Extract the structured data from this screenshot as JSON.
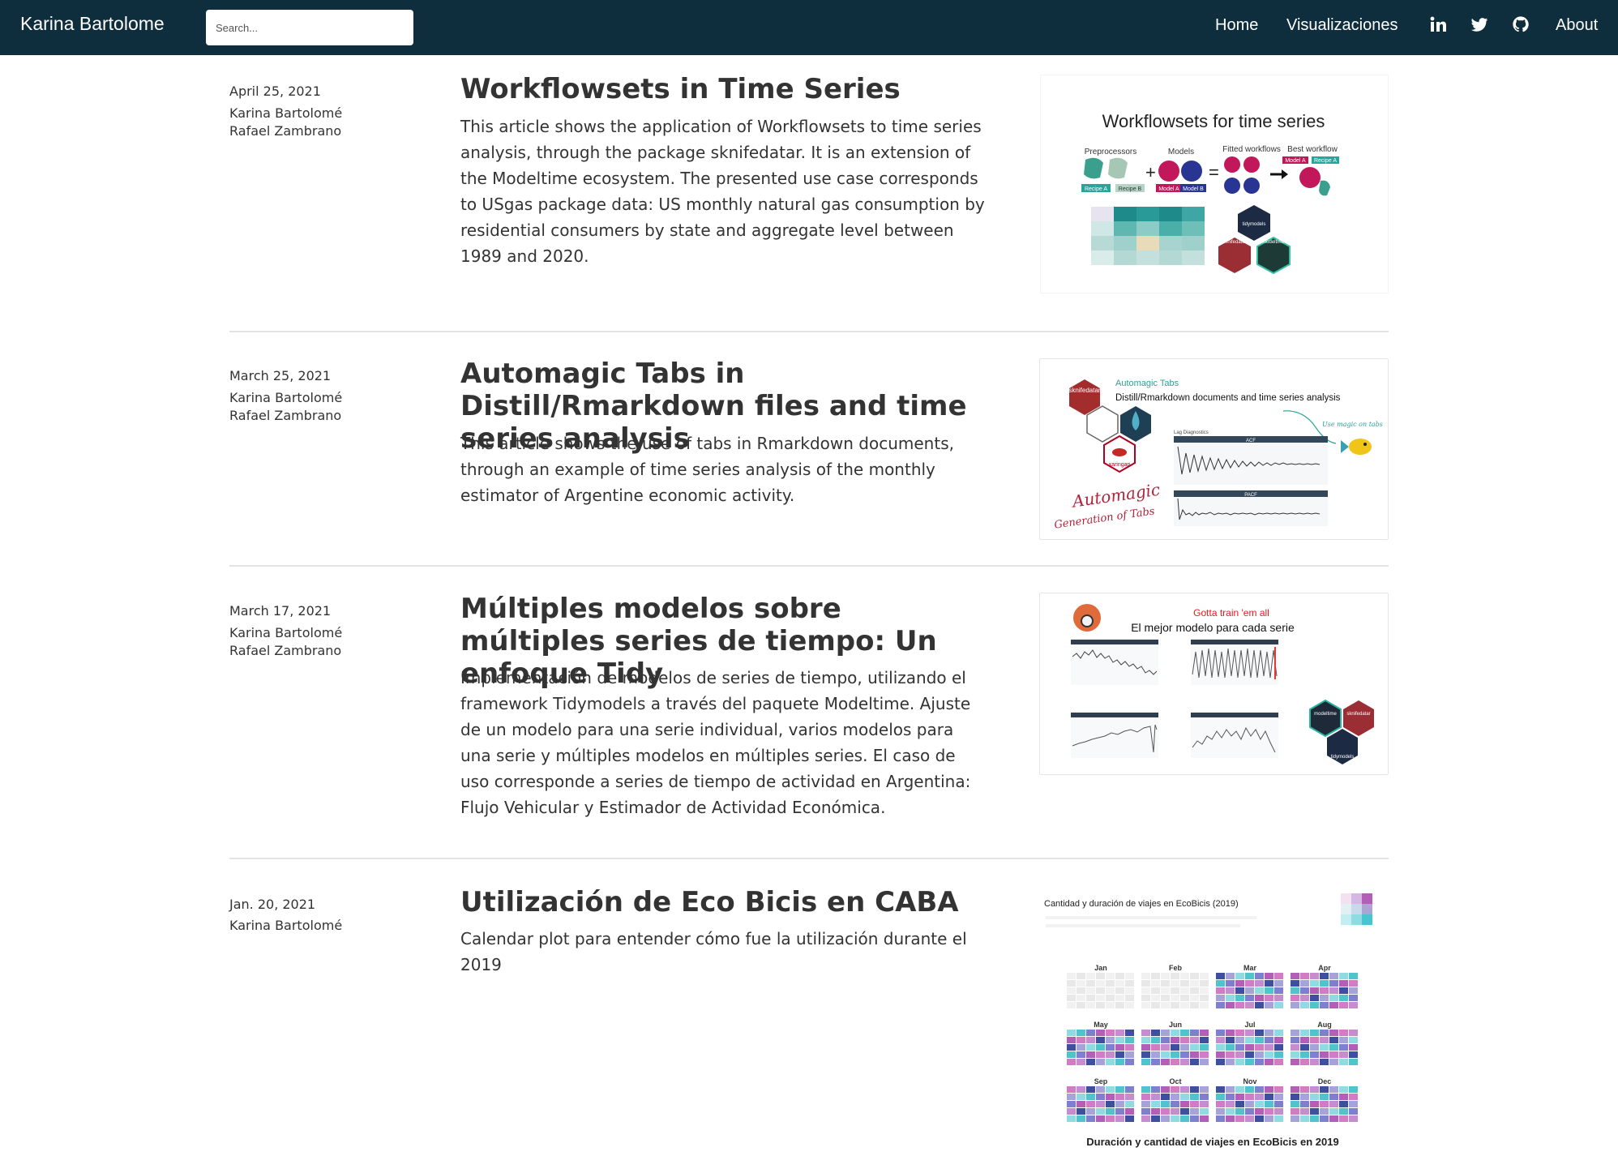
{
  "navbar": {
    "brand": "Karina Bartolome",
    "search_placeholder": "Search...",
    "links": {
      "home": "Home",
      "viz": "Visualizaciones",
      "about": "About"
    },
    "icons": [
      "linkedin-icon",
      "twitter-icon",
      "github-icon"
    ]
  },
  "articles": [
    {
      "date": "April 25, 2021",
      "authors": [
        "Karina Bartolomé",
        "Rafael Zambrano"
      ],
      "title": "Workflowsets in Time Series",
      "description": "This article shows the application of Workflowsets to time series analysis, through the package sknifedatar. It is an extension of the Modeltime ecosystem. The presented use case corresponds to USgas package data: US monthly natural gas consumption by residential consumers by state and aggregate level between 1989 and 2020.",
      "thumb": {
        "title": "Workflowsets for time series",
        "labels": [
          "Preprocessors",
          "Models",
          "Fitted workflows",
          "Best workflow"
        ],
        "tags": [
          "Recipe A",
          "Recipe B",
          "Model A",
          "Model B",
          "Model A",
          "Recipe A"
        ],
        "hex": [
          "tidymodels",
          "sknifedatar",
          "modeltime"
        ]
      }
    },
    {
      "date": "March 25, 2021",
      "authors": [
        "Karina Bartolomé",
        "Rafael Zambrano"
      ],
      "title": "Automagic Tabs in Distill/Rmarkdown files and time series analysis",
      "description": "This article shows the use of tabs in Rmarkdown documents, through an example of time series analysis of the monthly estimator of Argentine economic activity.",
      "thumb": {
        "kicker": "Automagic Tabs",
        "title": "Distill/Rmarkdown documents and time series analysis",
        "hex": [
          "sknifedatar",
          "xaringan"
        ],
        "script1": "Automagic",
        "script2": "Generation of Tabs",
        "note": "Use magic on tabs",
        "panel_title": "Lag Diagnostics",
        "acf": "ACF",
        "pacf": "PACF"
      }
    },
    {
      "date": "March 17, 2021",
      "authors": [
        "Karina Bartolomé",
        "Rafael Zambrano"
      ],
      "title": "Múltiples modelos sobre múltiples series de tiempo: Un enfoque Tidy",
      "description": "Implementación de modelos de series de tiempo, utilizando el framework Tidymodels a través del paquete Modeltime. Ajuste de un modelo para una serie individual, varios modelos para una serie y múltiples modelos en múltiples series. El caso de uso corresponde a series de tiempo de actividad en Argentina: Flujo Vehicular y Estimador de Actividad Económica.",
      "thumb": {
        "kicker": "Gotta train 'em all",
        "title": "El mejor modelo para cada serie",
        "hex": [
          "modeltime",
          "sknifedatar",
          "tidymodels"
        ]
      }
    },
    {
      "date": "Jan. 20, 2021",
      "authors": [
        "Karina Bartolomé"
      ],
      "title": "Utilización de Eco Bicis en CABA",
      "description": "Calendar plot para entender cómo fue la utilización durante el 2019",
      "thumb": {
        "title": "Cantidad y duración de viajes en EcoBicis (2019)",
        "footer": "Duración y cantidad de viajes en EcoBicis en 2019",
        "months": [
          "Jan",
          "Feb",
          "Mar",
          "Apr",
          "May",
          "Jun",
          "Jul",
          "Aug",
          "Sep",
          "Oct",
          "Nov",
          "Dec"
        ]
      }
    }
  ]
}
